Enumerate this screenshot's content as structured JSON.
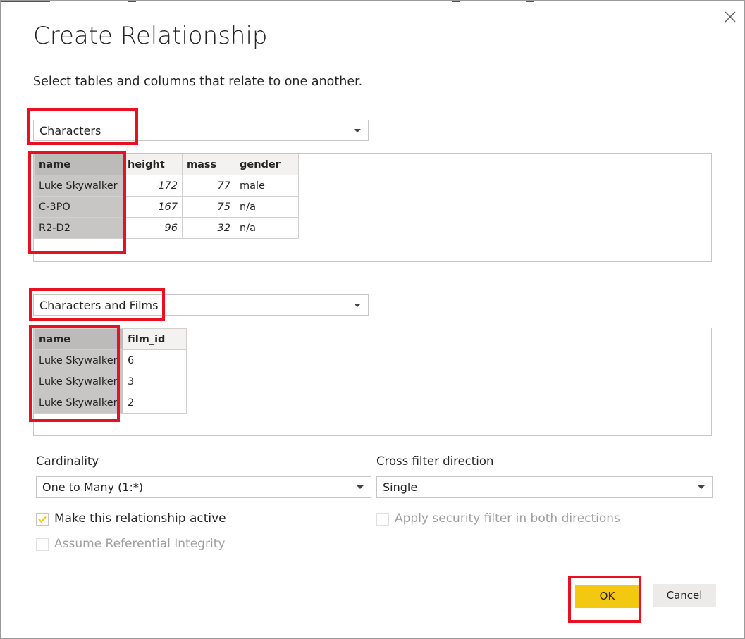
{
  "dialog": {
    "title": "Create Relationship",
    "subtitle": "Select tables and columns that relate to one another."
  },
  "table1": {
    "selected": "Characters",
    "columns": [
      "name",
      "height",
      "mass",
      "gender"
    ],
    "rows": [
      [
        "Luke Skywalker",
        "172",
        "77",
        "male"
      ],
      [
        "C-3PO",
        "167",
        "75",
        "n/a"
      ],
      [
        "R2-D2",
        "96",
        "32",
        "n/a"
      ]
    ],
    "selected_column": "name"
  },
  "table2": {
    "selected": "Characters and Films",
    "columns": [
      "name",
      "film_id"
    ],
    "rows": [
      [
        "Luke Skywalker",
        "6"
      ],
      [
        "Luke Skywalker",
        "3"
      ],
      [
        "Luke Skywalker",
        "2"
      ]
    ],
    "selected_column": "name"
  },
  "cardinality": {
    "label": "Cardinality",
    "value": "One to Many (1:*)"
  },
  "cross_filter": {
    "label": "Cross filter direction",
    "value": "Single"
  },
  "options": {
    "active_label": "Make this relationship active",
    "active_checked": true,
    "security_label": "Apply security filter in both directions",
    "security_checked": false,
    "integrity_label": "Assume Referential Integrity",
    "integrity_checked": false
  },
  "buttons": {
    "ok": "OK",
    "cancel": "Cancel"
  },
  "colors": {
    "accent": "#f2c811",
    "highlight": "#e81123",
    "check": "#f2c811"
  }
}
